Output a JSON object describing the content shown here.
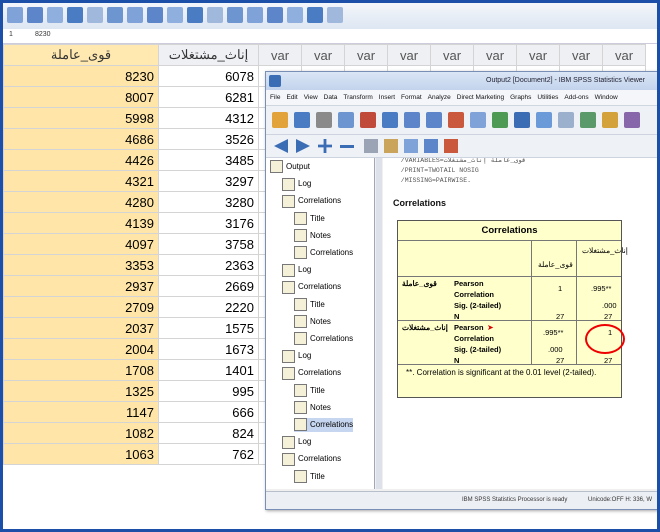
{
  "cell_editor": {
    "row": "1",
    "value": "8230"
  },
  "grid": {
    "headers": [
      "قوى_عاملة",
      "إناث_مشتغلات",
      "var",
      "var",
      "var",
      "var",
      "var",
      "var",
      "var",
      "var",
      "var"
    ],
    "rows": [
      [
        "8230",
        "6078"
      ],
      [
        "8007",
        "6281"
      ],
      [
        "5998",
        "4312"
      ],
      [
        "4686",
        "3526"
      ],
      [
        "4426",
        "3485"
      ],
      [
        "4321",
        "3297"
      ],
      [
        "4280",
        "3280"
      ],
      [
        "4139",
        "3176"
      ],
      [
        "4097",
        "3758"
      ],
      [
        "3353",
        "2363"
      ],
      [
        "2937",
        "2669"
      ],
      [
        "2709",
        "2220"
      ],
      [
        "2037",
        "1575"
      ],
      [
        "2004",
        "1673"
      ],
      [
        "1708",
        "1401"
      ],
      [
        "1325",
        "995"
      ],
      [
        "1147",
        "666"
      ],
      [
        "1082",
        "824"
      ],
      [
        "1063",
        "762"
      ]
    ]
  },
  "viewer": {
    "title": "Output2 [Document2] - IBM SPSS Statistics Viewer",
    "menu": [
      "File",
      "Edit",
      "View",
      "Data",
      "Transform",
      "Insert",
      "Format",
      "Analyze",
      "Direct Marketing",
      "Graphs",
      "Utilities",
      "Add-ons",
      "Window"
    ],
    "nav": [
      {
        "label": "Output",
        "level": 0
      },
      {
        "label": "Log",
        "level": 1
      },
      {
        "label": "Correlations",
        "level": 1
      },
      {
        "label": "Title",
        "level": 2
      },
      {
        "label": "Notes",
        "level": 2
      },
      {
        "label": "Correlations",
        "level": 2
      },
      {
        "label": "Log",
        "level": 1
      },
      {
        "label": "Correlations",
        "level": 1
      },
      {
        "label": "Title",
        "level": 2
      },
      {
        "label": "Notes",
        "level": 2
      },
      {
        "label": "Correlations",
        "level": 2
      },
      {
        "label": "Log",
        "level": 1
      },
      {
        "label": "Correlations",
        "level": 1
      },
      {
        "label": "Title",
        "level": 2
      },
      {
        "label": "Notes",
        "level": 2
      },
      {
        "label": "Correlations",
        "level": 2,
        "selected": true
      },
      {
        "label": "Log",
        "level": 1
      },
      {
        "label": "Correlations",
        "level": 1
      },
      {
        "label": "Title",
        "level": 2
      }
    ],
    "syntax": "  /VARIABLES=قوى_عاملة إناث_مشتغلات\n  /PRINT=TWOTAIL NOSIG\n  /MISSING=PAIRWISE.",
    "section_heading": "Correlations",
    "table": {
      "title": "Correlations",
      "col1": "قوى_عاملة",
      "col2": "إناث_مشتغلات",
      "row1_label": "قوى_عاملة",
      "row2_label": "إناث_مشتغلات",
      "stat_pearson": "Pearson Correlation",
      "stat_pearson_a": "Pearson",
      "stat_pearson_b": "Correlation",
      "stat_sig": "Sig. (2-tailed)",
      "stat_n": "N",
      "r1_pearson_c1": "1",
      "r1_pearson_c2": ".995**",
      "r1_sig_c2": ".000",
      "r1_n_c1": "27",
      "r1_n_c2": "27",
      "r2_pearson_c1": ".995**",
      "r2_pearson_c2": "1",
      "r2_sig_c1": ".000",
      "r2_n_c1": "27",
      "r2_n_c2": "27",
      "footnote": "**. Correlation is significant at the 0.01 level (2-tailed)."
    },
    "status": {
      "processor": "IBM SPSS Statistics Processor is ready",
      "unicode": "Unicode:OFF  H: 336, W"
    }
  }
}
